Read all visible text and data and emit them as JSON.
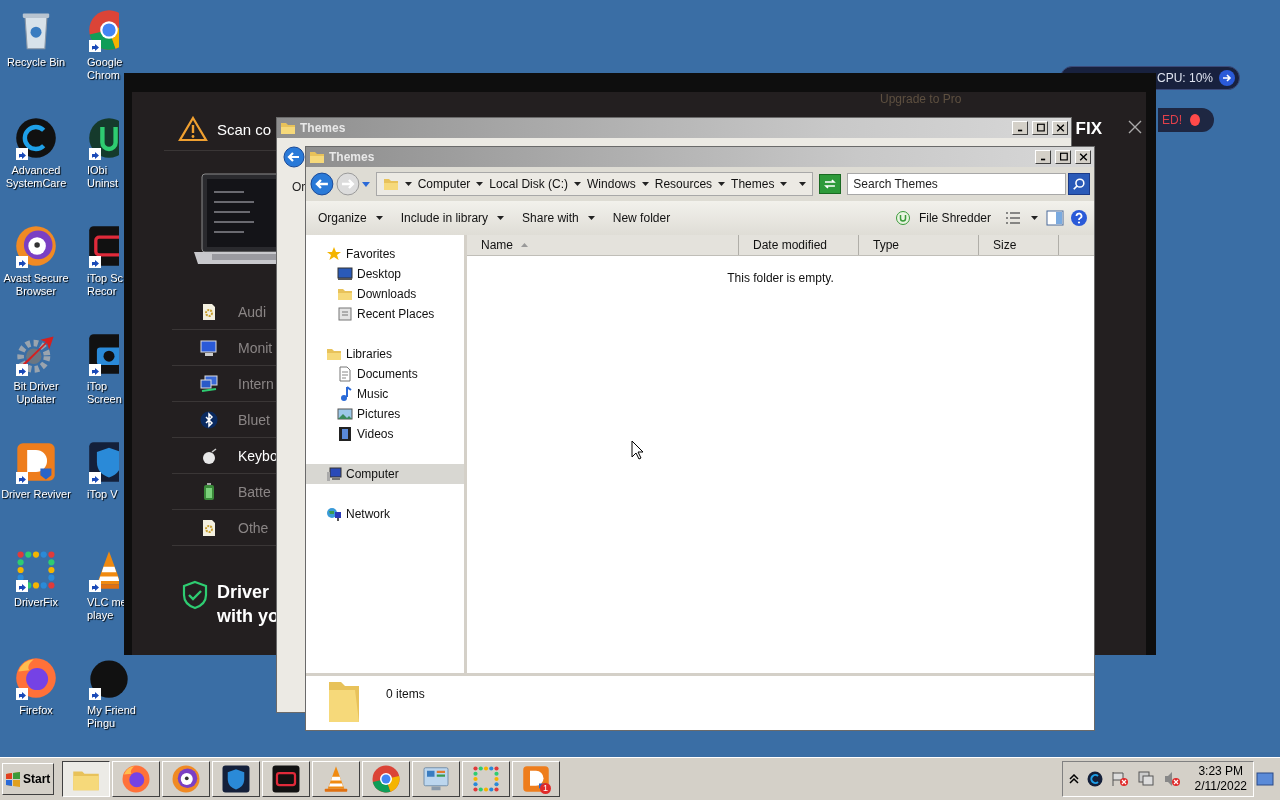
{
  "desktop_icons": [
    {
      "lines": [
        "Recycle Bin"
      ],
      "shortcut": false
    },
    {
      "lines": [
        "Google",
        "Chrom"
      ],
      "shortcut": true
    },
    {
      "lines": [
        "Advanced",
        "SystemCare"
      ],
      "shortcut": true
    },
    {
      "lines": [
        "IObi",
        "Uninst"
      ],
      "shortcut": true
    },
    {
      "lines": [
        "Avast Secure",
        "Browser"
      ],
      "shortcut": true
    },
    {
      "lines": [
        "iTop Sc",
        "Recor"
      ],
      "shortcut": true
    },
    {
      "lines": [
        "Bit Driver",
        "Updater"
      ],
      "shortcut": true
    },
    {
      "lines": [
        "iTop",
        "Screen"
      ],
      "shortcut": true
    },
    {
      "lines": [
        "Driver Reviver"
      ],
      "shortcut": true
    },
    {
      "lines": [
        "iTop V"
      ],
      "shortcut": true
    },
    {
      "lines": [
        "DriverFix"
      ],
      "shortcut": true
    },
    {
      "lines": [
        "VLC me",
        "playe"
      ],
      "shortcut": true
    },
    {
      "lines": [
        "Firefox"
      ],
      "shortcut": true
    },
    {
      "lines": [
        "My Friend",
        "Pingu"
      ],
      "shortcut": true
    }
  ],
  "widgets": {
    "cpu": "CPU: 10%",
    "alert": "ED!"
  },
  "driverfix": {
    "upgrade": "Upgrade to Pro",
    "scan_title": "Scan co",
    "logo_part": "FIX",
    "devices": [
      {
        "label": "Audi",
        "selected": false
      },
      {
        "label": "Monit",
        "selected": false
      },
      {
        "label": "Intern",
        "selected": false
      },
      {
        "label": "Bluet",
        "selected": false
      },
      {
        "label": "Keybo",
        "selected": true
      },
      {
        "label": "Batte",
        "selected": false
      },
      {
        "label": "Othe",
        "selected": false
      }
    ],
    "footer_lines": [
      "Driver",
      "with yo"
    ]
  },
  "back_window": {
    "title": "Themes",
    "toolbar_part": "Or"
  },
  "explorer": {
    "title": "Themes",
    "breadcrumb": [
      "Computer",
      "Local Disk (C:)",
      "Windows",
      "Resources",
      "Themes"
    ],
    "search": {
      "placeholder": "Search Themes"
    },
    "toolbar": [
      {
        "label": "Organize",
        "has_menu": true
      },
      {
        "label": "Include in library",
        "has_menu": true
      },
      {
        "label": "Share with",
        "has_menu": true
      },
      {
        "label": "New folder",
        "has_menu": false
      }
    ],
    "shredder": "File Shredder",
    "nav": [
      {
        "label": "Favorites",
        "selected": false,
        "children": [
          {
            "label": "Desktop",
            "selected": false
          },
          {
            "label": "Downloads",
            "selected": false
          },
          {
            "label": "Recent Places",
            "selected": false
          }
        ]
      },
      {
        "label": "Libraries",
        "selected": false,
        "children": [
          {
            "label": "Documents",
            "selected": false
          },
          {
            "label": "Music",
            "selected": false
          },
          {
            "label": "Pictures",
            "selected": false
          },
          {
            "label": "Videos",
            "selected": false
          }
        ]
      },
      {
        "label": "Computer",
        "selected": true
      },
      {
        "label": "Network",
        "selected": false
      }
    ],
    "columns": [
      {
        "label": "Name",
        "sorted": true
      },
      {
        "label": "Date modified",
        "sorted": false
      },
      {
        "label": "Type",
        "sorted": false
      },
      {
        "label": "Size",
        "sorted": false
      }
    ],
    "empty_message": "This folder is empty.",
    "status": "0 items"
  },
  "taskbar": {
    "start": "Start",
    "apps": [
      {
        "selected": true
      },
      {
        "selected": false
      },
      {
        "selected": false
      },
      {
        "selected": false
      },
      {
        "selected": false
      },
      {
        "selected": false
      },
      {
        "selected": false
      },
      {
        "selected": false
      },
      {
        "selected": false
      },
      {
        "selected": false,
        "badge": "1"
      }
    ],
    "time": "3:23 PM",
    "date": "2/11/2022"
  }
}
